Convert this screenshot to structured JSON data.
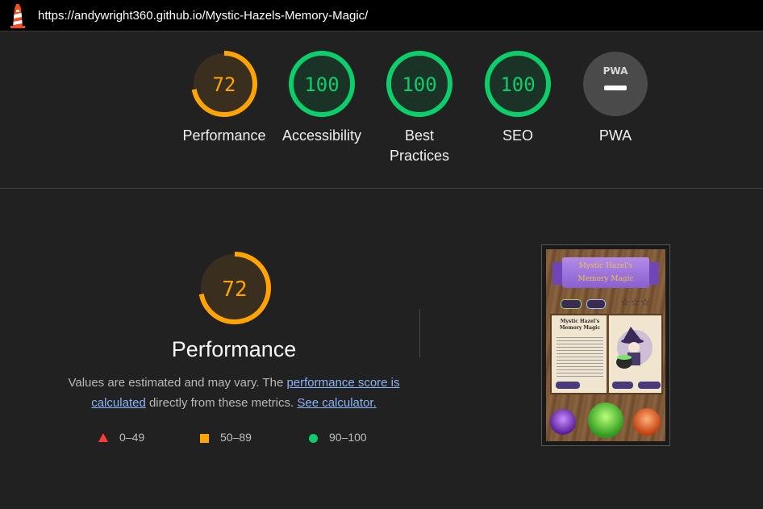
{
  "browser": {
    "url": "https://andywright360.github.io/Mystic-Hazels-Memory-Magic/",
    "logo_icon": "lighthouse-icon"
  },
  "gauges": [
    {
      "id": "performance",
      "score": 72,
      "display": "72",
      "label": "Performance",
      "status": "average",
      "color": "#ffa400",
      "fill": "#3a2e1f"
    },
    {
      "id": "accessibility",
      "score": 100,
      "display": "100",
      "label": "Accessibility",
      "status": "pass",
      "color": "#0cce6b",
      "fill": "#1b3327"
    },
    {
      "id": "best-practices",
      "score": 100,
      "display": "100",
      "label_line1": "Best",
      "label_line2": "Practices",
      "status": "pass",
      "color": "#0cce6b",
      "fill": "#1b3327"
    },
    {
      "id": "seo",
      "score": 100,
      "display": "100",
      "label": "SEO",
      "status": "pass",
      "color": "#0cce6b",
      "fill": "#1b3327"
    },
    {
      "id": "pwa",
      "display": "PWA",
      "label": "PWA",
      "status": "not-applicable",
      "color": "#555555",
      "fill": "#4a4a4a",
      "icon": "pwa-badge-icon"
    }
  ],
  "detail": {
    "score": 72,
    "score_display": "72",
    "title": "Performance",
    "desc_prefix": "Values are estimated and may vary. The ",
    "desc_link1": "performance score is calculated",
    "desc_middle": " directly from these metrics. ",
    "desc_link2": "See calculator."
  },
  "legend": [
    {
      "shape": "triangle",
      "range": "0–49",
      "color": "#ff3b3b"
    },
    {
      "shape": "square",
      "range": "50–89",
      "color": "#ffa400"
    },
    {
      "shape": "circle",
      "range": "90–100",
      "color": "#0cce6b"
    }
  ],
  "screenshot": {
    "banner_line1": "Mystic Hazel's",
    "banner_line2": "Memory Magic",
    "book_title_line1": "Mystic Hazel's",
    "book_title_line2": "Memory Magic",
    "buttons": [
      "How To Play",
      "New Game",
      "High Scores"
    ],
    "stars": "☆☆☆"
  }
}
